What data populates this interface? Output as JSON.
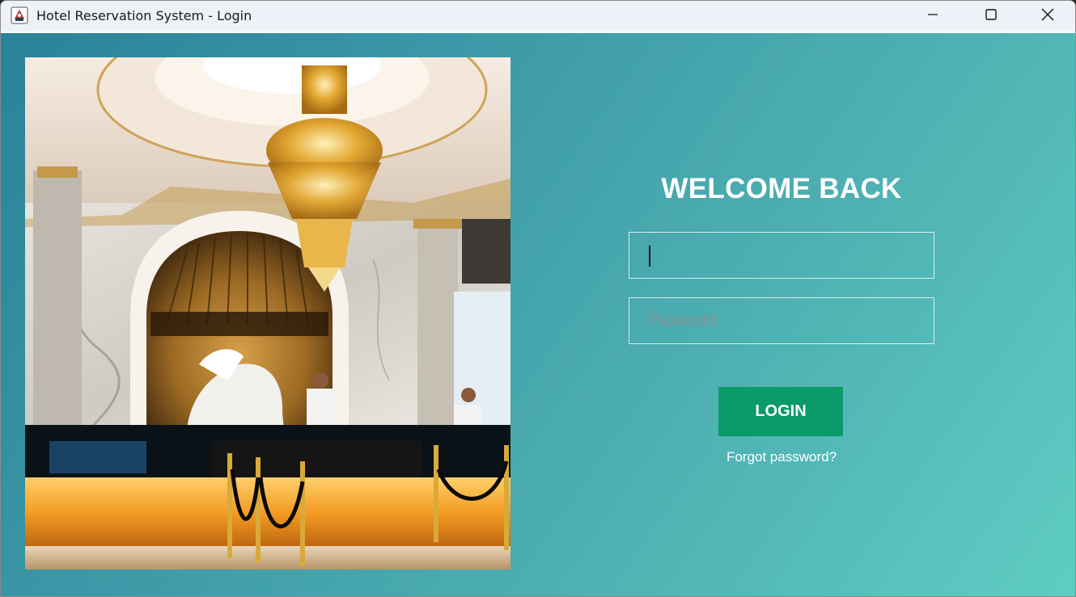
{
  "window": {
    "title": "Hotel Reservation System - Login",
    "icon": "java-coffee-cup-icon"
  },
  "controls": {
    "minimize_icon": "minimize-icon",
    "maximize_icon": "maximize-icon",
    "close_icon": "close-icon"
  },
  "photo": {
    "subject": "hotel-lobby-photo"
  },
  "login": {
    "heading": "WELCOME BACK",
    "username_value": "",
    "password_placeholder": "Password",
    "login_label": "LOGIN",
    "forgot_label": "Forgot password?"
  },
  "colors": {
    "gradient_start": "#2a8298",
    "gradient_end": "#5ecdc3",
    "button": "#0b9a6a",
    "text": "#ffffff"
  }
}
